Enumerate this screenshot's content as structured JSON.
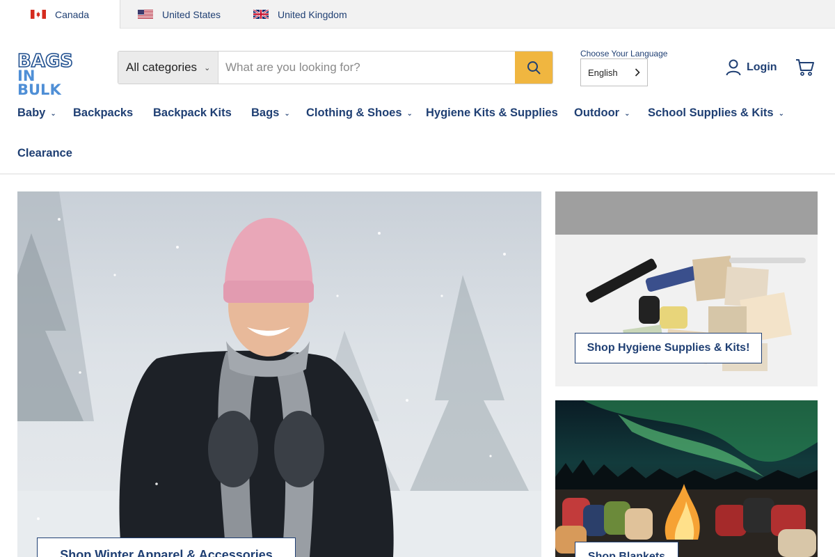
{
  "regions": [
    {
      "label": "Canada",
      "flag": "canada-flag-icon"
    },
    {
      "label": "United States",
      "flag": "us-flag-icon"
    },
    {
      "label": "United Kingdom",
      "flag": "uk-flag-icon"
    }
  ],
  "logo": {
    "line1": "BAGS",
    "line2": "IN BULK"
  },
  "search": {
    "category": "All categories",
    "placeholder": "What are you looking for?",
    "button_icon": "search-icon"
  },
  "language": {
    "label": "Choose Your Language",
    "selected": "English"
  },
  "account": {
    "login": "Login",
    "cart_icon": "cart-icon"
  },
  "nav": [
    {
      "label": "Baby",
      "dropdown": true
    },
    {
      "label": "Backpacks",
      "dropdown": false
    },
    {
      "label": "Backpack Kits",
      "dropdown": false
    },
    {
      "label": "Bags",
      "dropdown": true
    },
    {
      "label": "Clothing & Shoes",
      "dropdown": true
    },
    {
      "label": "Hygiene Kits & Supplies",
      "dropdown": false
    },
    {
      "label": "Outdoor",
      "dropdown": true
    },
    {
      "label": "School Supplies & Kits",
      "dropdown": true
    },
    {
      "label": "Clearance",
      "dropdown": false
    }
  ],
  "tiles": {
    "winter": {
      "button": "Shop Winter Apparel & Accessories"
    },
    "hygiene": {
      "button": "Shop Hygiene Supplies & Kits!"
    },
    "blankets": {
      "button": "Shop Blankets"
    }
  },
  "colors": {
    "brand_navy": "#1f3f73",
    "accent_gold": "#f0b640",
    "logo_blue": "#4f8fd6"
  }
}
